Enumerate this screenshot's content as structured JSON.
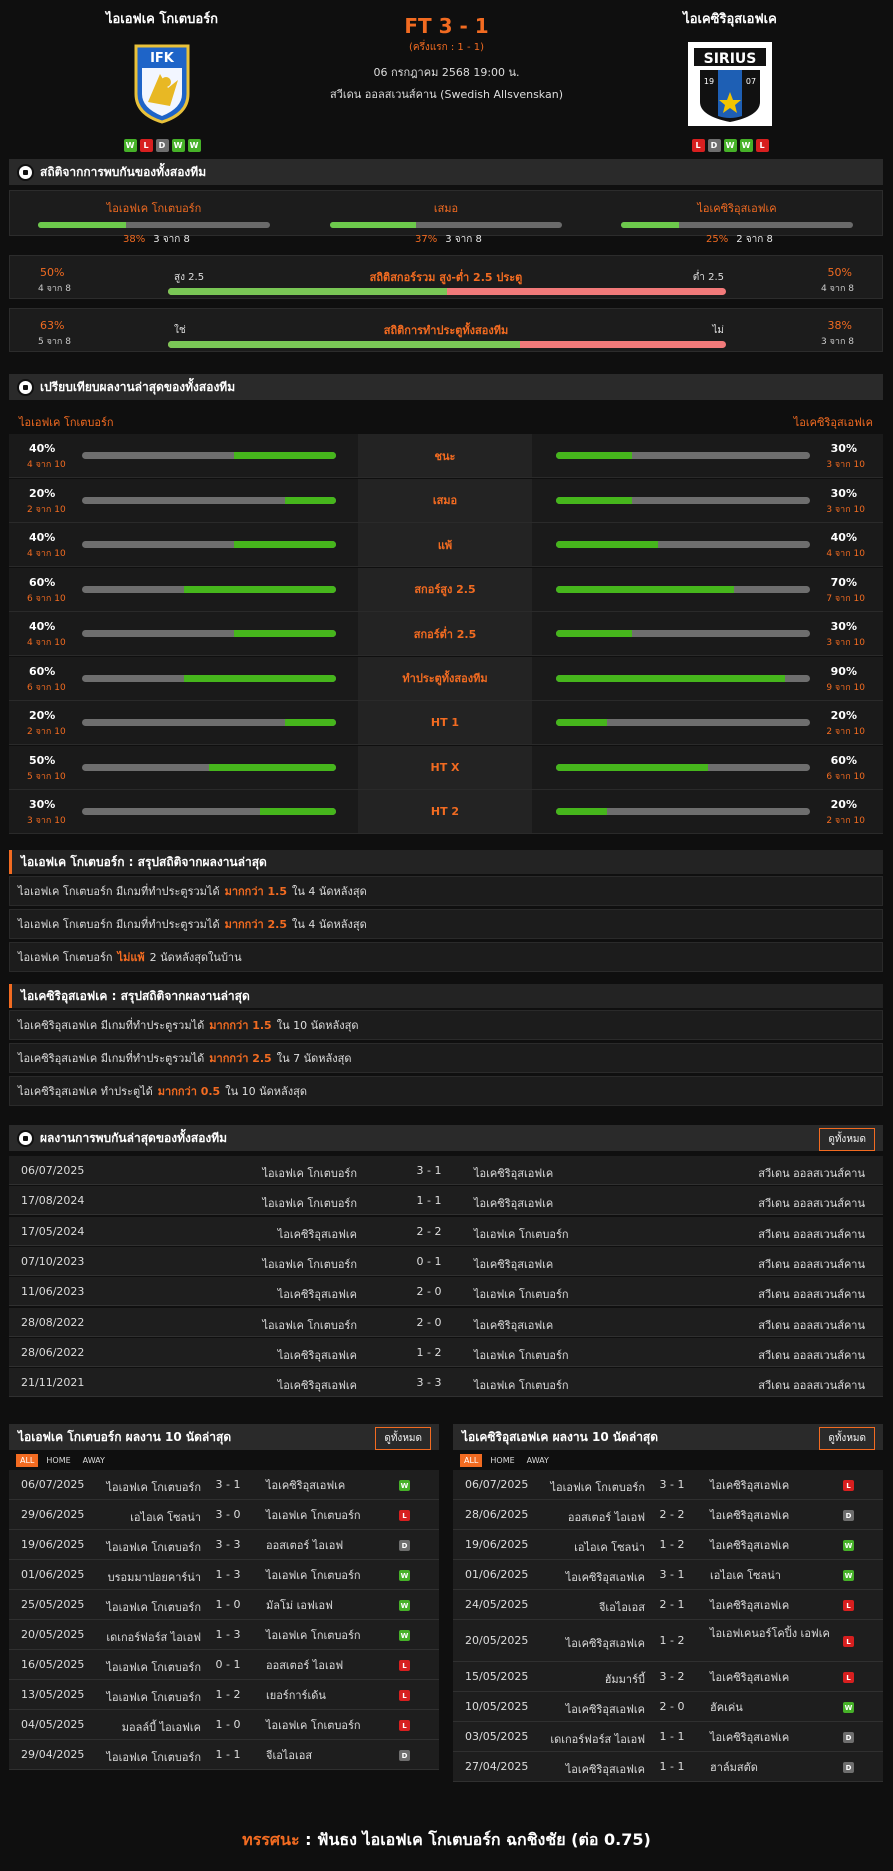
{
  "match": {
    "home": "ไอเอฟเค โกเตบอร์ก",
    "away": "ไอเคซิริอุสเอฟเค",
    "score": "FT 3 - 1",
    "half": "(ครึ่งแรก : 1 - 1)",
    "date": "06 กรกฎาคม 2568 19:00 น.",
    "league": "สวีเดน ออลสเวนส์คาน (Swedish Allsvenskan)",
    "home_logo_text": "IFK",
    "away_logo_text": "SIRIUS",
    "away_logo_year_l": "19",
    "away_logo_year_r": "07"
  },
  "home_form": [
    "W",
    "L",
    "D",
    "W",
    "W"
  ],
  "away_form": [
    "L",
    "D",
    "W",
    "W",
    "L"
  ],
  "h2h": {
    "title": "สถิติจากการพบกันของทั้งสองทีม",
    "cols": [
      {
        "label": "ไอเอฟเค โกเตบอร์ก",
        "pct": "38%",
        "sub": "3 จาก 8",
        "value": 0.38
      },
      {
        "label": "เสมอ",
        "pct": "37%",
        "sub": "3 จาก 8",
        "value": 0.37
      },
      {
        "label": "ไอเคซิริอุสเอฟเค",
        "pct": "25%",
        "sub": "2 จาก 8",
        "value": 0.25
      }
    ]
  },
  "ou": {
    "title": "สถิติสกอร์รวม สูง-ต่ำ 2.5 ประตู",
    "left_label": "สูง 2.5",
    "right_label": "ต่ำ 2.5",
    "lp": "50%",
    "lps": "4 จาก 8",
    "rp": "50%",
    "rps": "4 จาก 8",
    "value": 0.5
  },
  "btts": {
    "title": "สถิติการทำประตูทั้งสองทีม",
    "left_label": "ใช่",
    "right_label": "ไม่",
    "lp": "63%",
    "lps": "5 จาก 8",
    "rp": "38%",
    "rps": "3 จาก 8",
    "value": 0.63
  },
  "compare": {
    "title": "เปรียบเทียบผลงานล่าสุดของทั้งสองทีม",
    "home": "ไอเอฟเค โกเตบอร์ก",
    "away": "ไอเคซิริอุสเอฟเค",
    "rows": [
      {
        "label": "ชนะ",
        "lp": "40%",
        "ls": "4 จาก 10",
        "lv": 0.4,
        "rp": "30%",
        "rs": "3 จาก 10",
        "rv": 0.3
      },
      {
        "label": "เสมอ",
        "lp": "20%",
        "ls": "2 จาก 10",
        "lv": 0.2,
        "rp": "30%",
        "rs": "3 จาก 10",
        "rv": 0.3
      },
      {
        "label": "แพ้",
        "lp": "40%",
        "ls": "4 จาก 10",
        "lv": 0.4,
        "rp": "40%",
        "rs": "4 จาก 10",
        "rv": 0.4
      },
      {
        "label": "สกอร์สูง 2.5",
        "lp": "60%",
        "ls": "6 จาก 10",
        "lv": 0.6,
        "rp": "70%",
        "rs": "7 จาก 10",
        "rv": 0.7
      },
      {
        "label": "สกอร์ต่ำ 2.5",
        "lp": "40%",
        "ls": "4 จาก 10",
        "lv": 0.4,
        "rp": "30%",
        "rs": "3 จาก 10",
        "rv": 0.3
      },
      {
        "label": "ทำประตูทั้งสองทีม",
        "lp": "60%",
        "ls": "6 จาก 10",
        "lv": 0.6,
        "rp": "90%",
        "rs": "9 จาก 10",
        "rv": 0.9
      },
      {
        "label": "HT 1",
        "lp": "20%",
        "ls": "2 จาก 10",
        "lv": 0.2,
        "rp": "20%",
        "rs": "2 จาก 10",
        "rv": 0.2
      },
      {
        "label": "HT X",
        "lp": "50%",
        "ls": "5 จาก 10",
        "lv": 0.5,
        "rp": "60%",
        "rs": "6 จาก 10",
        "rv": 0.6
      },
      {
        "label": "HT 2",
        "lp": "30%",
        "ls": "3 จาก 10",
        "lv": 0.3,
        "rp": "20%",
        "rs": "2 จาก 10",
        "rv": 0.2
      }
    ]
  },
  "summary_home": {
    "title": "ไอเอฟเค โกเตบอร์ก : สรุปสถิติจากผลงานล่าสุด",
    "rows": [
      {
        "pre": "ไอเอฟเค โกเตบอร์ก  มีเกมที่ทำประตูรวมได้",
        "hl": "มากกว่า 1.5",
        "post": "ใน 4 นัดหลังสุด"
      },
      {
        "pre": "ไอเอฟเค โกเตบอร์ก  มีเกมที่ทำประตูรวมได้",
        "hl": "มากกว่า 2.5",
        "post": "ใน 4 นัดหลังสุด"
      },
      {
        "pre": "ไอเอฟเค โกเตบอร์ก",
        "hl": "ไม่แพ้",
        "post": "2  นัดหลังสุดในบ้าน"
      }
    ]
  },
  "summary_away": {
    "title": "ไอเคซิริอุสเอฟเค : สรุปสถิติจากผลงานล่าสุด",
    "rows": [
      {
        "pre": "ไอเคซิริอุสเอฟเค  มีเกมที่ทำประตูรวมได้",
        "hl": "มากกว่า 1.5",
        "post": "ใน 10 นัดหลังสุด"
      },
      {
        "pre": "ไอเคซิริอุสเอฟเค  มีเกมที่ทำประตูรวมได้",
        "hl": "มากกว่า 2.5",
        "post": "ใน 7 นัดหลังสุด"
      },
      {
        "pre": "ไอเคซิริอุสเอฟเค  ทำประตูได้",
        "hl": "มากกว่า 0.5",
        "post": "ใน 10 นัดหลังสุด"
      }
    ]
  },
  "history": {
    "title": "ผลงานการพบกันล่าสุดของทั้งสองทีม",
    "see_all": "ดูทั้งหมด",
    "rows": [
      {
        "d": "06/07/2025",
        "h": "ไอเอฟเค โกเตบอร์ก",
        "s": "3 - 1",
        "a": "ไอเคซิริอุสเอฟเค",
        "lg": "สวีเดน ออลสเวนส์คาน"
      },
      {
        "d": "17/08/2024",
        "h": "ไอเอฟเค โกเตบอร์ก",
        "s": "1 - 1",
        "a": "ไอเคซิริอุสเอฟเค",
        "lg": "สวีเดน ออลสเวนส์คาน"
      },
      {
        "d": "17/05/2024",
        "h": "ไอเคซิริอุสเอฟเค",
        "s": "2 - 2",
        "a": "ไอเอฟเค โกเตบอร์ก",
        "lg": "สวีเดน ออลสเวนส์คาน"
      },
      {
        "d": "07/10/2023",
        "h": "ไอเอฟเค โกเตบอร์ก",
        "s": "0 - 1",
        "a": "ไอเคซิริอุสเอฟเค",
        "lg": "สวีเดน ออลสเวนส์คาน"
      },
      {
        "d": "11/06/2023",
        "h": "ไอเคซิริอุสเอฟเค",
        "s": "2 - 0",
        "a": "ไอเอฟเค โกเตบอร์ก",
        "lg": "สวีเดน ออลสเวนส์คาน"
      },
      {
        "d": "28/08/2022",
        "h": "ไอเอฟเค โกเตบอร์ก",
        "s": "2 - 0",
        "a": "ไอเคซิริอุสเอฟเค",
        "lg": "สวีเดน ออลสเวนส์คาน"
      },
      {
        "d": "28/06/2022",
        "h": "ไอเคซิริอุสเอฟเค",
        "s": "1 - 2",
        "a": "ไอเอฟเค โกเตบอร์ก",
        "lg": "สวีเดน ออลสเวนส์คาน"
      },
      {
        "d": "21/11/2021",
        "h": "ไอเคซิริอุสเอฟเค",
        "s": "3 - 3",
        "a": "ไอเอฟเค โกเตบอร์ก",
        "lg": "สวีเดน ออลสเวนส์คาน"
      }
    ]
  },
  "tabs": [
    "ALL",
    "HOME",
    "AWAY"
  ],
  "last10_home": {
    "title": "ไอเอฟเค โกเตบอร์ก ผลงาน 10 นัดล่าสุด",
    "see_all": "ดูทั้งหมด",
    "rows": [
      {
        "d": "06/07/2025",
        "h": "ไอเอฟเค โกเตบอร์ก",
        "s": "3 - 1",
        "a": "ไอเคซิริอุสเอฟเค",
        "r": "W"
      },
      {
        "d": "29/06/2025",
        "h": "เอไอเค โซลน่า",
        "s": "3 - 0",
        "a": "ไอเอฟเค โกเตบอร์ก",
        "r": "L"
      },
      {
        "d": "19/06/2025",
        "h": "ไอเอฟเค โกเตบอร์ก",
        "s": "3 - 3",
        "a": "ออสเตอร์ ไอเอฟ",
        "r": "D"
      },
      {
        "d": "01/06/2025",
        "h": "บรอมมาปอยคาร์น่า",
        "s": "1 - 3",
        "a": "ไอเอฟเค โกเตบอร์ก",
        "r": "W"
      },
      {
        "d": "25/05/2025",
        "h": "ไอเอฟเค โกเตบอร์ก",
        "s": "1 - 0",
        "a": "มัลโม่ เอฟเอฟ",
        "r": "W"
      },
      {
        "d": "20/05/2025",
        "h": "เดเกอร์ฟอร์ส ไอเอฟ",
        "s": "1 - 3",
        "a": "ไอเอฟเค โกเตบอร์ก",
        "r": "W"
      },
      {
        "d": "16/05/2025",
        "h": "ไอเอฟเค โกเตบอร์ก",
        "s": "0 - 1",
        "a": "ออสเตอร์ ไอเอฟ",
        "r": "L"
      },
      {
        "d": "13/05/2025",
        "h": "ไอเอฟเค โกเตบอร์ก",
        "s": "1 - 2",
        "a": "เยอร์การ์เด้น",
        "r": "L"
      },
      {
        "d": "04/05/2025",
        "h": "มอลล์บี้ ไอเอฟเค",
        "s": "1 - 0",
        "a": "ไอเอฟเค โกเตบอร์ก",
        "r": "L"
      },
      {
        "d": "29/04/2025",
        "h": "ไอเอฟเค โกเตบอร์ก",
        "s": "1 - 1",
        "a": "จีเอไอเอส",
        "r": "D"
      }
    ]
  },
  "last10_away": {
    "title": "ไอเคซิริอุสเอฟเค ผลงาน 10 นัดล่าสุด",
    "see_all": "ดูทั้งหมด",
    "rows": [
      {
        "d": "06/07/2025",
        "h": "ไอเอฟเค โกเตบอร์ก",
        "s": "3 - 1",
        "a": "ไอเคซิริอุสเอฟเค",
        "r": "L"
      },
      {
        "d": "28/06/2025",
        "h": "ออสเตอร์ ไอเอฟ",
        "s": "2 - 2",
        "a": "ไอเคซิริอุสเอฟเค",
        "r": "D"
      },
      {
        "d": "19/06/2025",
        "h": "เอไอเค โซลน่า",
        "s": "1 - 2",
        "a": "ไอเคซิริอุสเอฟเค",
        "r": "W"
      },
      {
        "d": "01/06/2025",
        "h": "ไอเคซิริอุสเอฟเค",
        "s": "3 - 1",
        "a": "เอไอเค โซลน่า",
        "r": "W"
      },
      {
        "d": "24/05/2025",
        "h": "จีเอไอเอส",
        "s": "2 - 1",
        "a": "ไอเคซิริอุสเอฟเค",
        "r": "L"
      },
      {
        "d": "20/05/2025",
        "h": "ไอเคซิริอุสเอฟเค",
        "s": "1 - 2",
        "a": "ไอเอฟเคนอร์โคปิ้ง เอฟเค",
        "r": "L"
      },
      {
        "d": "15/05/2025",
        "h": "ฮัมมาร์บี้",
        "s": "3 - 2",
        "a": "ไอเคซิริอุสเอฟเค",
        "r": "L"
      },
      {
        "d": "10/05/2025",
        "h": "ไอเคซิริอุสเอฟเค",
        "s": "2 - 0",
        "a": "ฮัคเค่น",
        "r": "W"
      },
      {
        "d": "03/05/2025",
        "h": "เดเกอร์ฟอร์ส ไอเอฟ",
        "s": "1 - 1",
        "a": "ไอเคซิริอุสเอฟเค",
        "r": "D"
      },
      {
        "d": "27/04/2025",
        "h": "ไอเคซิริอุสเอฟเค",
        "s": "1 - 1",
        "a": "ฮาล์มสตัด",
        "r": "D"
      }
    ]
  },
  "prediction": {
    "label": "ทรรศนะ",
    "sep": ":",
    "text": "ฟันธง ไอเอฟเค โกเตบอร์ก ฉกชิงชัย (ต่อ 0.75)"
  }
}
